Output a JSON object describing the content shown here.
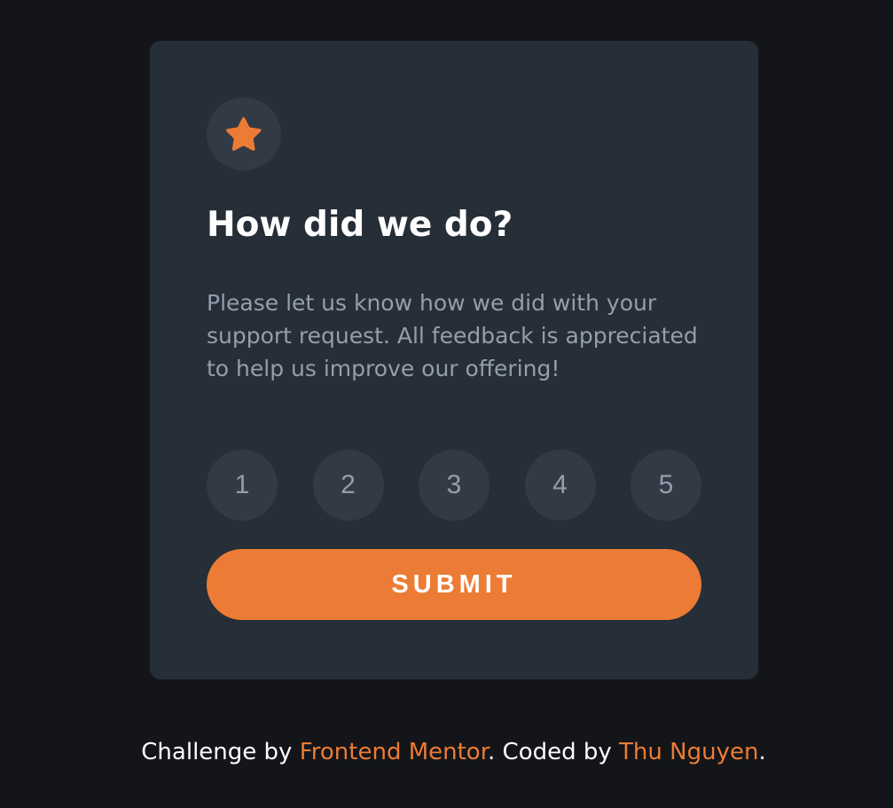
{
  "card": {
    "title": "How did we do?",
    "description": "Please let us know how we did with your support request. All feedback is appreciated to help us improve our offering!",
    "ratings": [
      "1",
      "2",
      "3",
      "4",
      "5"
    ],
    "submit_label": "SUBMIT",
    "icon": "star-icon"
  },
  "attribution": {
    "prefix": "Challenge by ",
    "challenge_link": "Frontend Mentor",
    "middle": ". Coded by ",
    "author_link": "Thu Nguyen",
    "suffix": "."
  },
  "colors": {
    "background": "#131518",
    "card": "#262e38",
    "circle": "#323a45",
    "accent": "#ec7c35",
    "muted_text": "#959eac",
    "white": "#ffffff"
  }
}
